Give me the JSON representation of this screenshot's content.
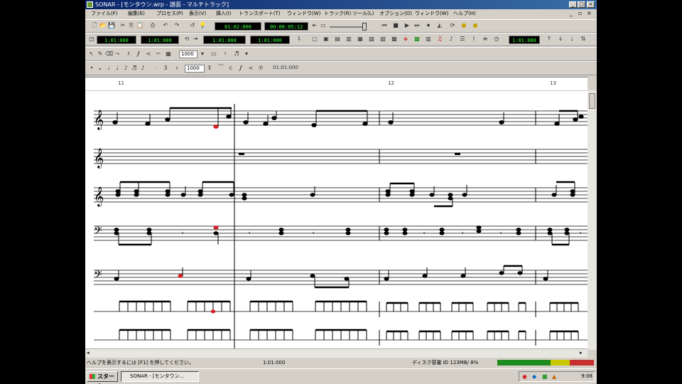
{
  "window": {
    "title": "SONAR - [モンタウン.wrp - 譜面 - マルチトラック]"
  },
  "menu": [
    "ファイル(F)",
    "編集(E)",
    "プロセス(P)",
    "表示(V)",
    "挿入(I)",
    "トランスポート(T)",
    "ウィンドウ(W)",
    "トラック(R)",
    "ツール(L)",
    "オプション(O)",
    "ウィンドウ(W)",
    "ヘルプ(H)"
  ],
  "transport": {
    "time_display": "01:02:000",
    "time_display2": "00:00:05:12",
    "left_counters": [
      "1:01:000",
      "1:01:000"
    ],
    "loop_counters": [
      "1:01:000",
      "1:01:000"
    ],
    "tempo_display": "1:01:000"
  },
  "notation_toolbar": {
    "resolution_value": "1000",
    "duration_value": "1000",
    "time_readout": "01:01:000"
  },
  "ruler": {
    "markers": [
      "11",
      "12",
      "13"
    ]
  },
  "status": {
    "help_text": "ヘルプを表示するには [F1] を押してください。",
    "position": "1:01:000",
    "disk_info": "ディスク容量 ID 123MB/ 8%"
  },
  "taskbar": {
    "start_label": "スタート",
    "task_label": "SONAR - [モンタウン...",
    "clock": "9:08"
  },
  "colors": {
    "titlebar": "#0a246a",
    "note_black": "#000000",
    "note_red": "#d81e1e",
    "lcd_text": "#3cff3c"
  }
}
